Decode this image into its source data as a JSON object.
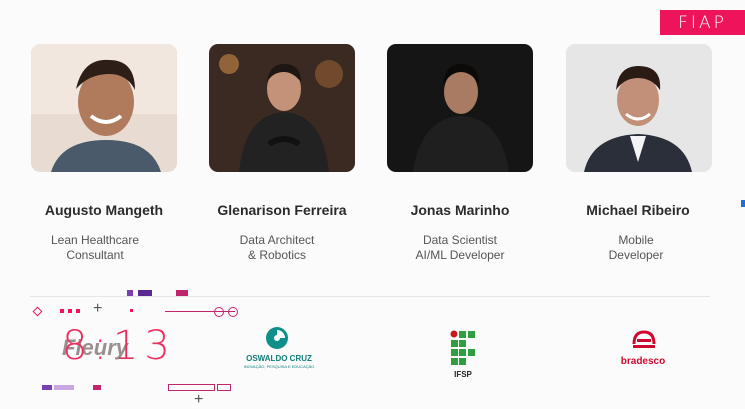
{
  "brand": {
    "logo_text": "FIAP",
    "accent": "#ed145b"
  },
  "speakers": [
    {
      "name": "Augusto Mangeth",
      "role_line1": "Lean Healthcare",
      "role_line2": "Consultant"
    },
    {
      "name": "Glenarison Ferreira",
      "role_line1": "Data Architect",
      "role_line2": "& Robotics"
    },
    {
      "name": "Jonas Marinho",
      "role_line1": "Data Scientist",
      "role_line2": "AI/ML Developer"
    },
    {
      "name": "Michael Ribeiro",
      "role_line1": "Mobile",
      "role_line2": "Developer"
    }
  ],
  "overlay": {
    "timer": "8:13"
  },
  "sponsors": [
    {
      "name": "Fleury",
      "icon": "fleury-logo"
    },
    {
      "name": "OSWALDO CRUZ",
      "tagline": "INOVAÇÃO, PESQUISA E EDUCAÇÃO",
      "icon": "oswaldo-cruz-logo"
    },
    {
      "name": "IFSP",
      "icon": "ifsp-logo"
    },
    {
      "name": "bradesco",
      "icon": "bradesco-logo"
    }
  ]
}
